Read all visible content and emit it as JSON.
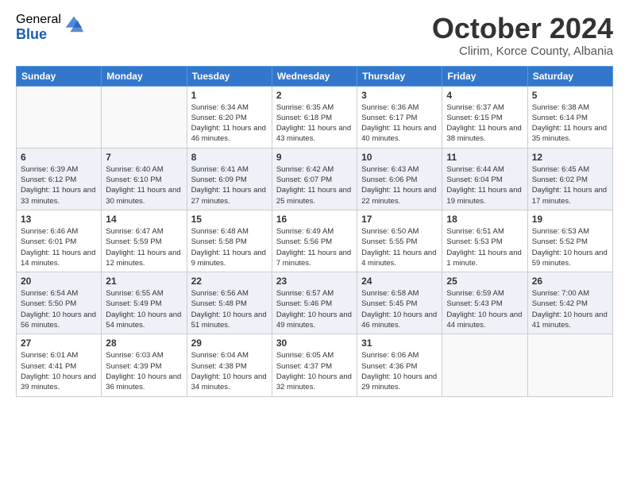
{
  "logo": {
    "general": "General",
    "blue": "Blue"
  },
  "title": "October 2024",
  "location": "Clirim, Korce County, Albania",
  "days_of_week": [
    "Sunday",
    "Monday",
    "Tuesday",
    "Wednesday",
    "Thursday",
    "Friday",
    "Saturday"
  ],
  "weeks": [
    [
      {
        "day": "",
        "info": ""
      },
      {
        "day": "",
        "info": ""
      },
      {
        "day": "1",
        "info": "Sunrise: 6:34 AM\nSunset: 6:20 PM\nDaylight: 11 hours and 46 minutes."
      },
      {
        "day": "2",
        "info": "Sunrise: 6:35 AM\nSunset: 6:18 PM\nDaylight: 11 hours and 43 minutes."
      },
      {
        "day": "3",
        "info": "Sunrise: 6:36 AM\nSunset: 6:17 PM\nDaylight: 11 hours and 40 minutes."
      },
      {
        "day": "4",
        "info": "Sunrise: 6:37 AM\nSunset: 6:15 PM\nDaylight: 11 hours and 38 minutes."
      },
      {
        "day": "5",
        "info": "Sunrise: 6:38 AM\nSunset: 6:14 PM\nDaylight: 11 hours and 35 minutes."
      }
    ],
    [
      {
        "day": "6",
        "info": "Sunrise: 6:39 AM\nSunset: 6:12 PM\nDaylight: 11 hours and 33 minutes."
      },
      {
        "day": "7",
        "info": "Sunrise: 6:40 AM\nSunset: 6:10 PM\nDaylight: 11 hours and 30 minutes."
      },
      {
        "day": "8",
        "info": "Sunrise: 6:41 AM\nSunset: 6:09 PM\nDaylight: 11 hours and 27 minutes."
      },
      {
        "day": "9",
        "info": "Sunrise: 6:42 AM\nSunset: 6:07 PM\nDaylight: 11 hours and 25 minutes."
      },
      {
        "day": "10",
        "info": "Sunrise: 6:43 AM\nSunset: 6:06 PM\nDaylight: 11 hours and 22 minutes."
      },
      {
        "day": "11",
        "info": "Sunrise: 6:44 AM\nSunset: 6:04 PM\nDaylight: 11 hours and 19 minutes."
      },
      {
        "day": "12",
        "info": "Sunrise: 6:45 AM\nSunset: 6:02 PM\nDaylight: 11 hours and 17 minutes."
      }
    ],
    [
      {
        "day": "13",
        "info": "Sunrise: 6:46 AM\nSunset: 6:01 PM\nDaylight: 11 hours and 14 minutes."
      },
      {
        "day": "14",
        "info": "Sunrise: 6:47 AM\nSunset: 5:59 PM\nDaylight: 11 hours and 12 minutes."
      },
      {
        "day": "15",
        "info": "Sunrise: 6:48 AM\nSunset: 5:58 PM\nDaylight: 11 hours and 9 minutes."
      },
      {
        "day": "16",
        "info": "Sunrise: 6:49 AM\nSunset: 5:56 PM\nDaylight: 11 hours and 7 minutes."
      },
      {
        "day": "17",
        "info": "Sunrise: 6:50 AM\nSunset: 5:55 PM\nDaylight: 11 hours and 4 minutes."
      },
      {
        "day": "18",
        "info": "Sunrise: 6:51 AM\nSunset: 5:53 PM\nDaylight: 11 hours and 1 minute."
      },
      {
        "day": "19",
        "info": "Sunrise: 6:53 AM\nSunset: 5:52 PM\nDaylight: 10 hours and 59 minutes."
      }
    ],
    [
      {
        "day": "20",
        "info": "Sunrise: 6:54 AM\nSunset: 5:50 PM\nDaylight: 10 hours and 56 minutes."
      },
      {
        "day": "21",
        "info": "Sunrise: 6:55 AM\nSunset: 5:49 PM\nDaylight: 10 hours and 54 minutes."
      },
      {
        "day": "22",
        "info": "Sunrise: 6:56 AM\nSunset: 5:48 PM\nDaylight: 10 hours and 51 minutes."
      },
      {
        "day": "23",
        "info": "Sunrise: 6:57 AM\nSunset: 5:46 PM\nDaylight: 10 hours and 49 minutes."
      },
      {
        "day": "24",
        "info": "Sunrise: 6:58 AM\nSunset: 5:45 PM\nDaylight: 10 hours and 46 minutes."
      },
      {
        "day": "25",
        "info": "Sunrise: 6:59 AM\nSunset: 5:43 PM\nDaylight: 10 hours and 44 minutes."
      },
      {
        "day": "26",
        "info": "Sunrise: 7:00 AM\nSunset: 5:42 PM\nDaylight: 10 hours and 41 minutes."
      }
    ],
    [
      {
        "day": "27",
        "info": "Sunrise: 6:01 AM\nSunset: 4:41 PM\nDaylight: 10 hours and 39 minutes."
      },
      {
        "day": "28",
        "info": "Sunrise: 6:03 AM\nSunset: 4:39 PM\nDaylight: 10 hours and 36 minutes."
      },
      {
        "day": "29",
        "info": "Sunrise: 6:04 AM\nSunset: 4:38 PM\nDaylight: 10 hours and 34 minutes."
      },
      {
        "day": "30",
        "info": "Sunrise: 6:05 AM\nSunset: 4:37 PM\nDaylight: 10 hours and 32 minutes."
      },
      {
        "day": "31",
        "info": "Sunrise: 6:06 AM\nSunset: 4:36 PM\nDaylight: 10 hours and 29 minutes."
      },
      {
        "day": "",
        "info": ""
      },
      {
        "day": "",
        "info": ""
      }
    ]
  ]
}
